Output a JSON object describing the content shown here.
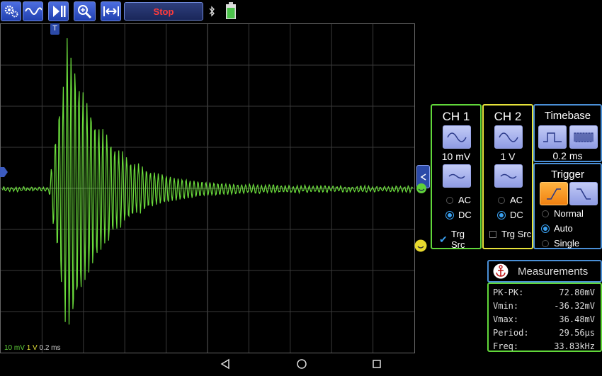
{
  "toolbar": {
    "stop_label": "Stop",
    "buttons": [
      "gear-icon",
      "waveform-icon",
      "play-pause-icon",
      "zoom-icon",
      "fit-width-icon"
    ],
    "status_icons": [
      "bluetooth-icon",
      "battery-icon"
    ]
  },
  "scope": {
    "status": {
      "ch1_scale": "10 mV",
      "ch2_scale": "1 V",
      "timebase": "0.2 ms"
    },
    "trigger_marker": "T",
    "waveform_color": "#6bdc3c"
  },
  "ch1": {
    "title": "CH 1",
    "scale": "10 mV",
    "coupling": [
      "AC",
      "DC"
    ],
    "selected": "DC",
    "trg_src_label": "Trg Src",
    "trg_src_checked": true,
    "border_color": "#61d73a"
  },
  "ch2": {
    "title": "CH 2",
    "scale": "1 V",
    "coupling": [
      "AC",
      "DC"
    ],
    "selected": "DC",
    "trg_src_label": "Trg Src",
    "trg_src_checked": false,
    "border_color": "#e6e33a"
  },
  "timebase": {
    "title": "Timebase",
    "value": "0.2 ms",
    "border_color": "#4a8fd6"
  },
  "trigger": {
    "title": "Trigger",
    "modes": [
      "Normal",
      "Auto",
      "Single"
    ],
    "selected": "Auto"
  },
  "measurements": {
    "title": "Measurements",
    "rows": [
      {
        "label": "PK-PK:",
        "value": "72.80mV"
      },
      {
        "label": "Vmin:",
        "value": "-36.32mV"
      },
      {
        "label": "Vmax:",
        "value": "36.48mV"
      },
      {
        "label": "Period:",
        "value": "29.56µs"
      },
      {
        "label": "Freq:",
        "value": "33.83kHz"
      }
    ]
  },
  "navbar": [
    "back-icon",
    "home-icon",
    "recents-icon"
  ]
}
